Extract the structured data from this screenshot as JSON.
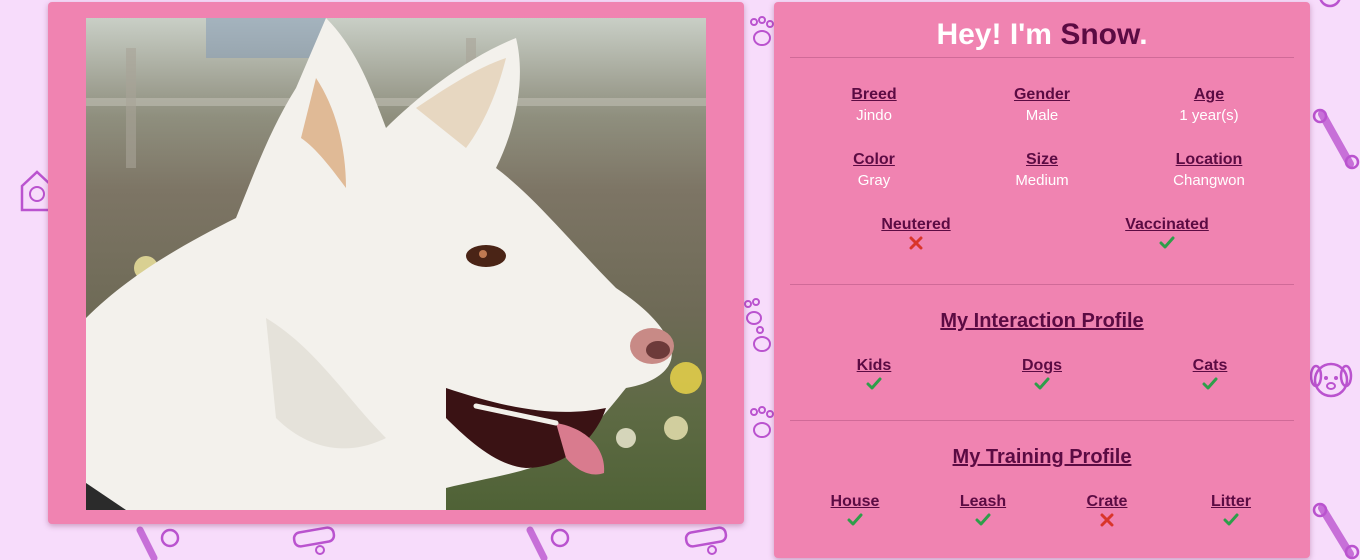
{
  "profile": {
    "title_prefix": "Hey! I'm",
    "name": "Snow",
    "title_suffix": ".",
    "photo_alt": "white jindo dog profile photo"
  },
  "details": {
    "breed": {
      "label": "Breed",
      "value": "Jindo"
    },
    "gender": {
      "label": "Gender",
      "value": "Male"
    },
    "age": {
      "label": "Age",
      "value": "1 year(s)"
    },
    "color": {
      "label": "Color",
      "value": "Gray"
    },
    "size": {
      "label": "Size",
      "value": "Medium"
    },
    "location": {
      "label": "Location",
      "value": "Changwon"
    },
    "neutered": {
      "label": "Neutered",
      "status": "no"
    },
    "vaccinated": {
      "label": "Vaccinated",
      "status": "yes"
    }
  },
  "interaction": {
    "title": "My Interaction Profile",
    "kids": {
      "label": "Kids",
      "status": "yes"
    },
    "dogs": {
      "label": "Dogs",
      "status": "yes"
    },
    "cats": {
      "label": "Cats",
      "status": "yes"
    }
  },
  "training": {
    "title": "My Training Profile",
    "house": {
      "label": "House",
      "status": "yes"
    },
    "leash": {
      "label": "Leash",
      "status": "yes"
    },
    "crate": {
      "label": "Crate",
      "status": "no"
    },
    "litter": {
      "label": "Litter",
      "status": "yes"
    }
  },
  "icons": {
    "yes": "check-icon",
    "no": "cross-icon"
  },
  "colors": {
    "background": "#f7dcfb",
    "card": "#f083b1",
    "accent": "#5b0b43",
    "yes": "#2e9e4a",
    "no": "#d9352a"
  }
}
